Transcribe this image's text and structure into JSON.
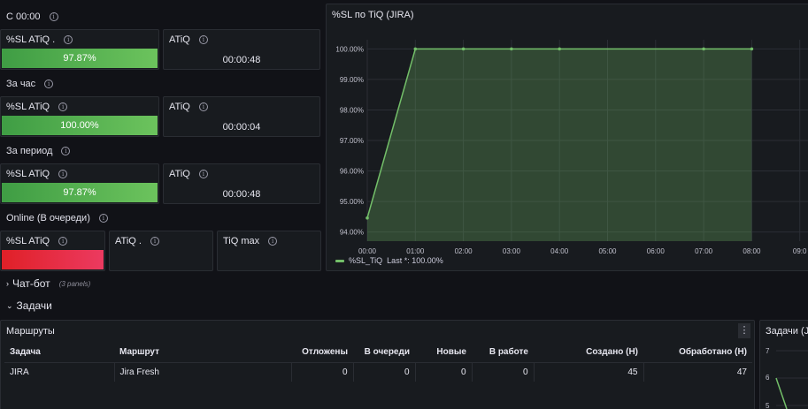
{
  "groups": {
    "c0000": "С 00:00",
    "za_chas": "За час",
    "za_period": "За период",
    "online": "Online (В очереди)"
  },
  "stats": {
    "row1": {
      "sl_title": "%SL ATiQ .",
      "sl_value": "97.87%",
      "atiq_title": "ATiQ",
      "atiq_value": "00:00:48"
    },
    "row2": {
      "sl_title": "%SL ATiQ",
      "sl_value": "100.00%",
      "atiq_title": "ATiQ",
      "atiq_value": "00:00:04"
    },
    "row3": {
      "sl_title": "%SL ATiQ",
      "sl_value": "97.87%",
      "atiq_title": "ATiQ",
      "atiq_value": "00:00:48"
    },
    "row4": {
      "sl_title": "%SL ATiQ",
      "atiq_title": "ATiQ .",
      "tiq_title": "TiQ max"
    }
  },
  "colors": {
    "green_start": "#3f9d44",
    "green_end": "#6cc35d",
    "red_start": "#e02027",
    "red_end": "#ec3a60",
    "series": "#73bf69"
  },
  "chart_panel": {
    "title": "%SL по TiQ (JIRA)",
    "legend": "%SL_TiQ  Last *: 100.00%"
  },
  "chart_data": {
    "type": "area",
    "title": "%SL по TiQ (JIRA)",
    "x": [
      "00:00",
      "01:00",
      "02:00",
      "03:00",
      "04:00",
      "05:00",
      "06:00",
      "07:00",
      "08:00"
    ],
    "x_ticks": [
      "00:00",
      "01:00",
      "02:00",
      "03:00",
      "04:00",
      "05:00",
      "06:00",
      "07:00",
      "08:00",
      "09:0"
    ],
    "y_ticks": [
      "94.00%",
      "95.00%",
      "96.00%",
      "97.00%",
      "98.00%",
      "99.00%",
      "100.00%"
    ],
    "ylim": [
      93.7,
      100.3
    ],
    "series": [
      {
        "name": "%SL_TiQ",
        "points": [
          [
            0,
            94.46
          ],
          [
            1,
            100
          ],
          [
            2,
            100
          ],
          [
            3,
            100
          ],
          [
            4,
            100
          ],
          [
            7,
            100
          ],
          [
            8,
            100
          ]
        ]
      }
    ],
    "legend": "%SL_TiQ  Last *: 100.00%",
    "grid": true
  },
  "sections": {
    "chatbot": "Чат-бот",
    "chatbot_count": "(3 panels)",
    "tasks": "Задачи"
  },
  "routes": {
    "title": "Маршруты",
    "columns": [
      "Задача",
      "Маршрут",
      "Отложены",
      "В очереди",
      "Новые",
      "В работе",
      "Создано (Н)",
      "Обработано (Н)"
    ],
    "rows": [
      [
        "JIRA",
        "Jira Fresh",
        "0",
        "0",
        "0",
        "0",
        "45",
        "47"
      ]
    ]
  },
  "tasks_panel": {
    "title": "Задачи (JI",
    "y_ticks": [
      "7",
      "6",
      "5"
    ]
  }
}
